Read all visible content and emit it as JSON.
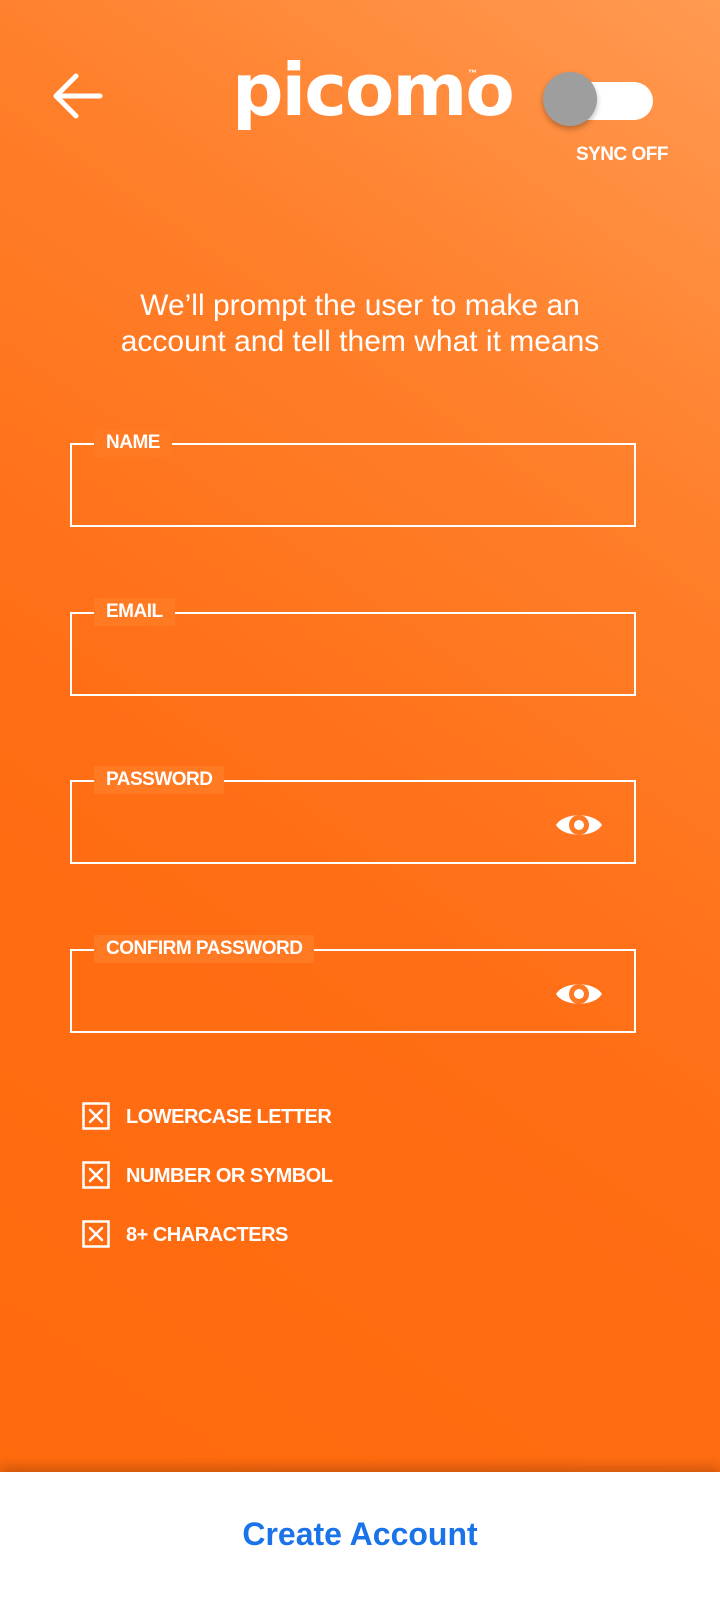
{
  "header": {
    "back_icon": "arrow-left-icon",
    "logo_text": "picomo",
    "logo_tm": "™",
    "sync": {
      "label": "SYNC OFF",
      "on": false
    }
  },
  "intro": {
    "headline": "We’ll prompt the user to make an\naccount and tell them what it means"
  },
  "form": {
    "name": {
      "label": "NAME",
      "value": "",
      "placeholder": ""
    },
    "email": {
      "label": "EMAIL",
      "value": "",
      "placeholder": ""
    },
    "password": {
      "label": "PASSWORD",
      "value": "",
      "placeholder": "",
      "icon": "eye-icon"
    },
    "confirm_password": {
      "label": "CONFIRM PASSWORD",
      "value": "",
      "placeholder": "",
      "icon": "eye-icon"
    }
  },
  "requirements": [
    {
      "label": "LOWERCASE LETTER",
      "met": false,
      "icon": "x-box-icon"
    },
    {
      "label": "NUMBER OR SYMBOL",
      "met": false,
      "icon": "x-box-icon"
    },
    {
      "label": "8+ CHARACTERS",
      "met": false,
      "icon": "x-box-icon"
    }
  ],
  "footer": {
    "create_label": "Create Account"
  },
  "colors": {
    "background_gradient_start": "#ff9a52",
    "background_gradient_end": "#ff6a0d",
    "foreground": "#ffffff",
    "toggle_knob": "#9e9e9e",
    "action_blue": "#1a73e8"
  }
}
